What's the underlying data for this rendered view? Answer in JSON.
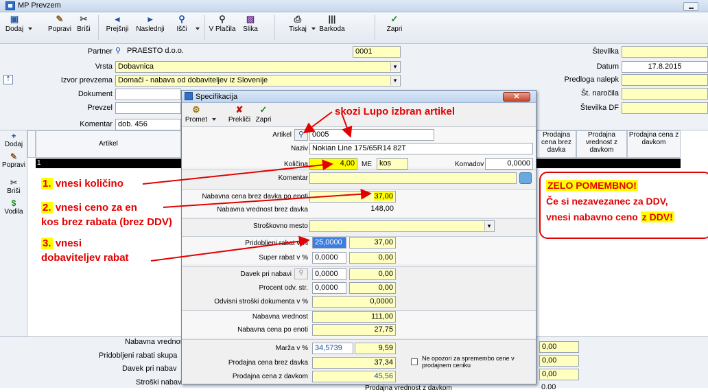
{
  "window": {
    "title": "MP Prevzem"
  },
  "toolbar": {
    "add": "Dodaj",
    "edit": "Popravi",
    "delete": "Briši",
    "prev": "Prejšnji",
    "next": "Naslednji",
    "search": "Išči",
    "payments": "V Plačila",
    "image": "Slika",
    "print": "Tiskaj",
    "barcode": "Barkoda",
    "close": "Zapri"
  },
  "header": {
    "partner_label": "Partner",
    "partner_value": "PRAESTO d.o.o.",
    "partner_code": "0001",
    "type_label": "Vrsta",
    "type_value": "Dobavnica",
    "source_label": "Izvor prevzema",
    "source_value": "Domači - nabava od dobaviteljev iz Slovenije",
    "document_label": "Dokument",
    "received_label": "Prevzel",
    "comment_label": "Komentar",
    "comment_value": "dob. 456",
    "number_label": "Številka",
    "date_label": "Datum",
    "date_value": "17.8.2015",
    "label_template_label": "Predloga nalepk",
    "order_no_label": "Št. naročila",
    "df_no_label": "Številka DF"
  },
  "sidebar": {
    "add": "Dodaj",
    "edit": "Popravi",
    "delete": "Briši",
    "guides": "Vodila"
  },
  "grid": {
    "article_col": "Artikel",
    "row_number": "1",
    "col_sale_net": "Prodajna cena brez davka",
    "col_sale_value": "Prodajna vrednost z davkom",
    "col_sale_gross": "Prodajna cena z davkom"
  },
  "summary": {
    "purchase_value": "Nabavna vrednos",
    "discounts": "Pridobljeni rabati skupa",
    "tax": "Davek pri nabav",
    "costs": "Stroški nabav",
    "sale_value": "Prodajna vrednost z davkom",
    "v1": "0,00",
    "v2": "0,00",
    "v3": "0,00",
    "v4": "0,00",
    "v5": "0,00"
  },
  "dialog": {
    "title": "Specifikacija",
    "promet": "Promet",
    "cancel": "Prekliči",
    "close": "Zapri",
    "article_label": "Artikel",
    "article_value": "0005",
    "name_label": "Naziv",
    "name_value": "Nokian Line 175/65R14 82T",
    "qty_label": "Količina",
    "qty_value": "4,00",
    "unit_label": "ME",
    "unit_value": "kos",
    "pieces_label": "Komadov",
    "pieces_value": "0,0000",
    "comment_label": "Komentar",
    "unit_price_label": "Nabavna cena brez davka po enoti",
    "unit_price_value": "37,00",
    "net_value_label": "Nabavna vrednost brez davka",
    "net_value_value": "148,00",
    "cost_center_label": "Stroškovno mesto",
    "discount_label": "Pridobljeni rabat v %",
    "discount_pct": "25,0000",
    "discount_amt": "37,00",
    "super_label": "Super rabat v %",
    "super_pct": "0,0000",
    "super_amt": "0,00",
    "tax_label": "Davek pri nabavi",
    "tax_pct": "0,0000",
    "tax_amt": "0,00",
    "dep_label": "Procent odv. str.",
    "dep_pct": "0,0000",
    "dep_amt": "0,00",
    "depcost_label": "Odvisni stroški dokumenta v %",
    "depcost_value": "0,0000",
    "purchase_value_label": "Nabavna vrednost",
    "purchase_value": "111,00",
    "purchase_unit_label": "Nabavna cena po enoti",
    "purchase_unit": "27,75",
    "margin_label": "Marža v %",
    "margin_pct": "34,5739",
    "margin_amt": "9,59",
    "sale_net_label": "Prodajna cena brez davka",
    "sale_net": "37,34",
    "sale_gross_label": "Prodajna cena z davkom",
    "sale_gross": "45,56",
    "no_warn_label": "Ne opozori za spremembo cene v prodajnem ceniku"
  },
  "annotations": {
    "lupa": "skozi Lupo izbran artikel",
    "step1_num": "1.",
    "step1": "vnesi količino",
    "step2_num": "2.",
    "step2": "vnesi ceno za en",
    "step2b": "kos brez rabata (brez DDV)",
    "step3_num": "3.",
    "step3": "vnesi",
    "step3b": "dobaviteljev rabat",
    "warn_title": "ZELO POMEMBNO!",
    "warn_l1": "Če si nezavezanec za DDV,",
    "warn_l2a": "vnesi nabavno ceno",
    "warn_l2b": "z DDV!"
  }
}
